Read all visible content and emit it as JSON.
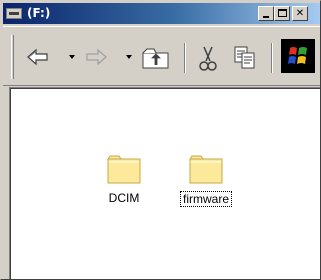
{
  "window": {
    "title": "(F:)"
  },
  "caption_buttons": {
    "minimize_icon": "minimize-icon",
    "maximize_icon": "maximize-icon",
    "close_label": "✕"
  },
  "toolbar": {
    "items": [
      {
        "icon": "back-arrow-icon"
      },
      {
        "icon": "forward-arrow-icon"
      },
      {
        "icon": "up-folder-icon"
      },
      {
        "icon": "cut-icon"
      },
      {
        "icon": "copy-icon"
      },
      {
        "icon": "windows-logo-icon"
      }
    ]
  },
  "folders": [
    {
      "label": "DCIM",
      "selected": false
    },
    {
      "label": "firmware",
      "selected": true
    }
  ],
  "colors": {
    "titlebar_start": "#0a246a",
    "titlebar_end": "#a6caf0",
    "folder_fill": "#fce99a",
    "folder_edge": "#c9a84a",
    "face": "#d4d0c8"
  }
}
